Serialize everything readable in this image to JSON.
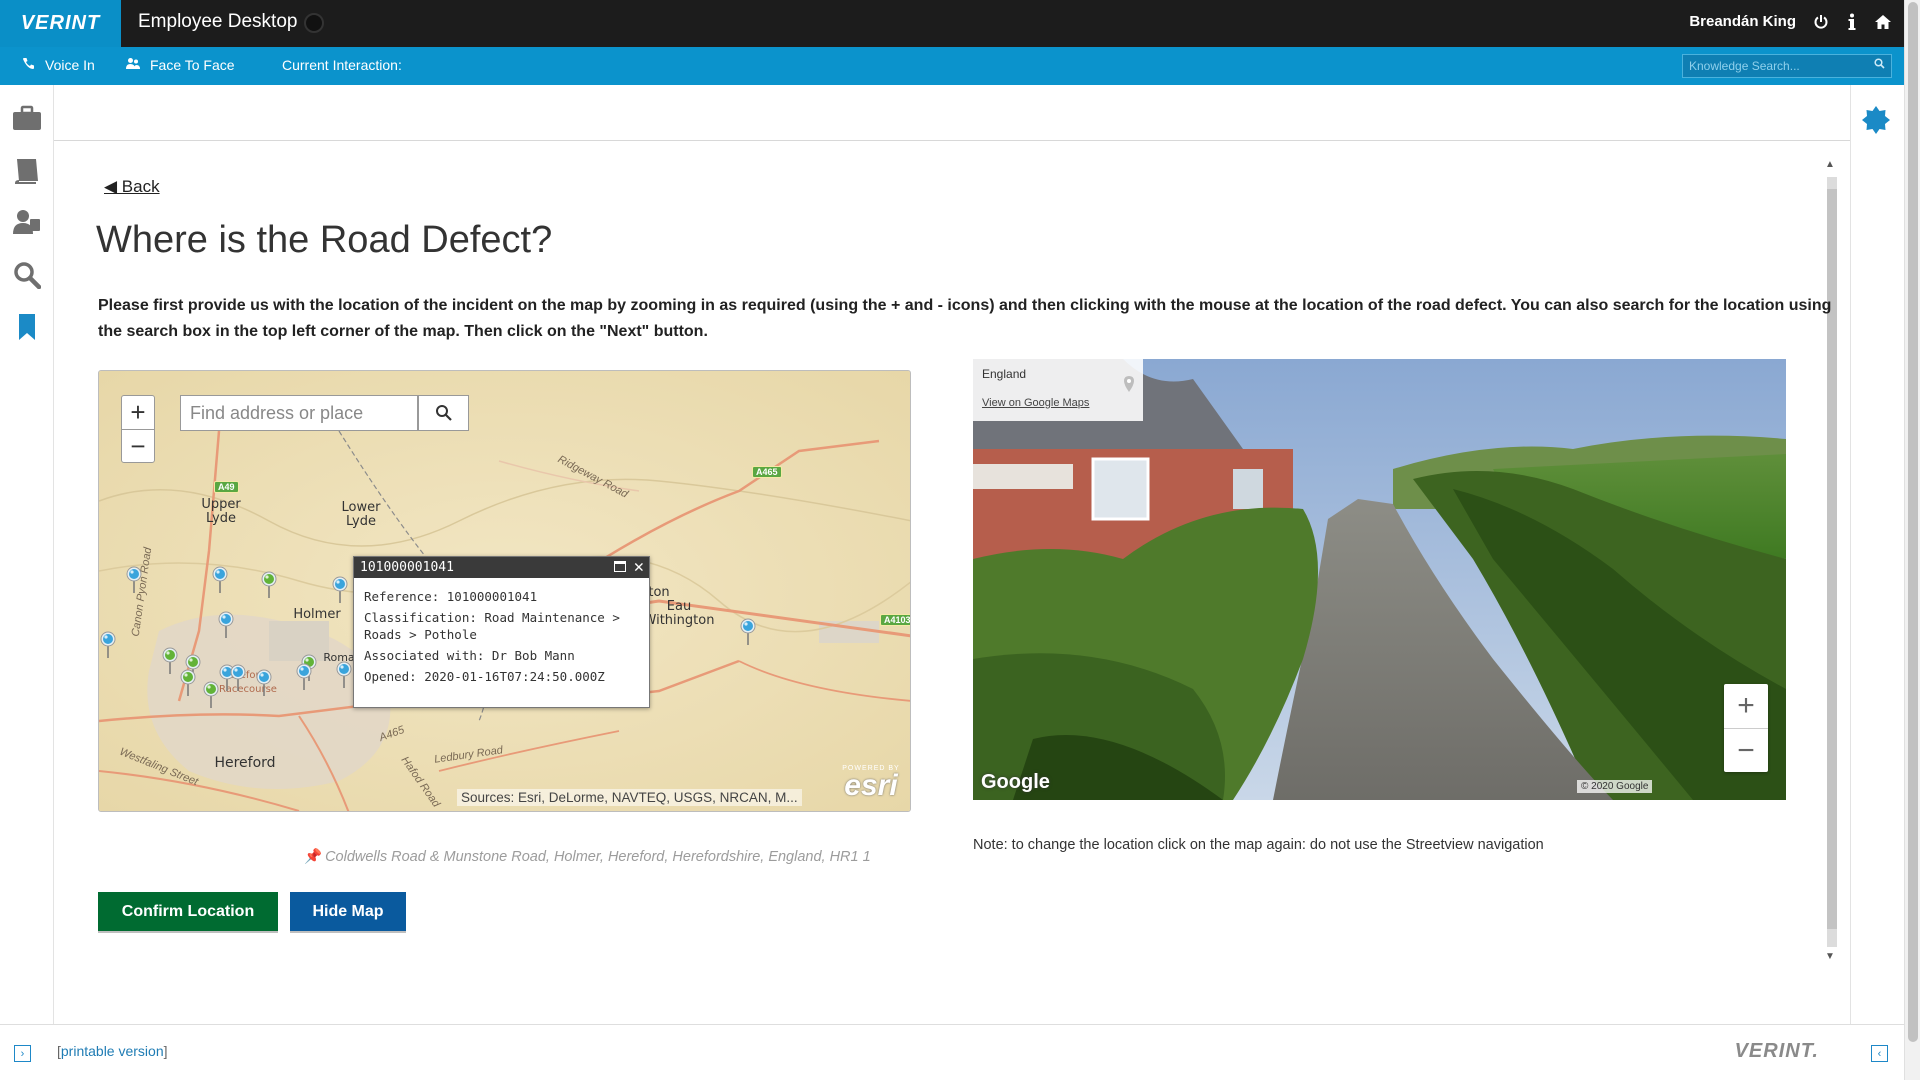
{
  "topbar": {
    "logo": "VERINT",
    "app_title": "Employee Desktop",
    "user_name": "Breandán King"
  },
  "subbar": {
    "voice_in": "Voice In",
    "face_to_face": "Face To Face",
    "current_interaction": "Current Interaction:",
    "knowledge_search_placeholder": "Knowledge Search..."
  },
  "left_rail": [
    "briefcase-icon",
    "book-icon",
    "users-icon",
    "search-icon",
    "bookmark-icon"
  ],
  "page": {
    "back_label": "◀ Back",
    "title": "Where is the Road Defect?",
    "instructions": "Please first provide us with the location of the incident on the map by zooming in as required (using the + and - icons) and then clicking with the mouse at the location of the road defect.  You can also search for the location using the search box in the top left corner of the map. Then click on the \"Next\" button."
  },
  "map": {
    "zoom_in": "+",
    "zoom_out": "−",
    "search_placeholder": "Find address or place",
    "places": {
      "upper_lyde": "Upper Lyde",
      "lower_lyde": "Lower Lyde",
      "holmer": "Holmer",
      "eau_withington": "Eau Withington",
      "hereford": "Hereford",
      "racecourse": "Hereford Racecourse",
      "ington": "ton",
      "roma": "Roma"
    },
    "roads": {
      "ridgeway": "Ridgeway Road",
      "canon_pyon": "Canon Pyon Road",
      "westfaling": "Westfaling Street",
      "ledbury": "Ledbury Road",
      "hafod": "Hafod Road",
      "a465_label": "A465"
    },
    "shields": [
      "A49",
      "A465",
      "A4103"
    ],
    "popup": {
      "title": "101000001041",
      "reference": "Reference: 101000001041",
      "classification": "Classification: Road Maintenance > Roads > Pothole",
      "associated": "Associated with: Dr Bob Mann",
      "opened": "Opened: 2020-01-16T07:24:50.000Z"
    },
    "attribution": "Sources: Esri, DeLorme, NAVTEQ, USGS, NRCAN, M...",
    "esri_powered": "POWERED BY",
    "esri_name": "esri"
  },
  "address": "Coldwells Road & Munstone Road, Holmer, Hereford, Herefordshire, England, HR1 1",
  "buttons": {
    "confirm": "Confirm Location",
    "hide_map": "Hide Map"
  },
  "streetview": {
    "region": "England",
    "view_link": "View on Google Maps",
    "zoom_in": "+",
    "zoom_out": "−",
    "brand": "Google",
    "copyright": "© 2020 Google"
  },
  "note": "Note: to change the location click on the map again:  do not use the Streetview navigation",
  "footer": {
    "printable_open": "[",
    "printable_link": "printable version",
    "printable_close": "]",
    "logo": "VERINT."
  },
  "colors": {
    "brand_blue": "#0b93cc",
    "topbar": "#1c1c1c",
    "confirm_green": "#006b31",
    "hide_blue": "#0a5a9e"
  }
}
